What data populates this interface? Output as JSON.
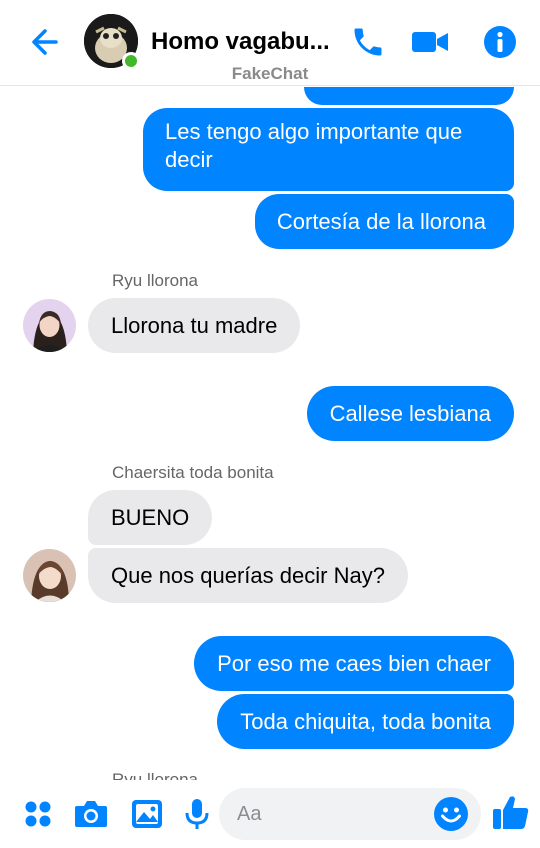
{
  "header": {
    "title": "Homo vagabu...",
    "subtitle": "FakeChat",
    "icons": [
      "back-arrow-icon",
      "phone-icon",
      "video-icon",
      "info-icon"
    ]
  },
  "messages": [
    {
      "type": "out",
      "text": "Les tengo algo importante que decir"
    },
    {
      "type": "out",
      "text": "Cortesía de la llorona"
    },
    {
      "type": "sender",
      "text": "Ryu llorona"
    },
    {
      "type": "in",
      "text": "Llorona tu madre"
    },
    {
      "type": "out",
      "text": "Callese lesbiana"
    },
    {
      "type": "sender",
      "text": "Chaersita toda bonita"
    },
    {
      "type": "in",
      "text": "BUENO"
    },
    {
      "type": "in",
      "text": "Que nos querías decir Nay?"
    },
    {
      "type": "out",
      "text": "Por eso me caes bien chaer"
    },
    {
      "type": "out",
      "text": "Toda chiquita, toda bonita"
    },
    {
      "type": "sender",
      "text": "Ryu llorona"
    }
  ],
  "composer": {
    "placeholder": "Aa",
    "icons": [
      "apps-icon",
      "camera-icon",
      "gallery-icon",
      "microphone-icon",
      "emoji-icon",
      "like-icon"
    ]
  },
  "colors": {
    "accent": "#0084ff",
    "incoming_bubble": "#e9e9eb",
    "online": "#42b72a"
  }
}
